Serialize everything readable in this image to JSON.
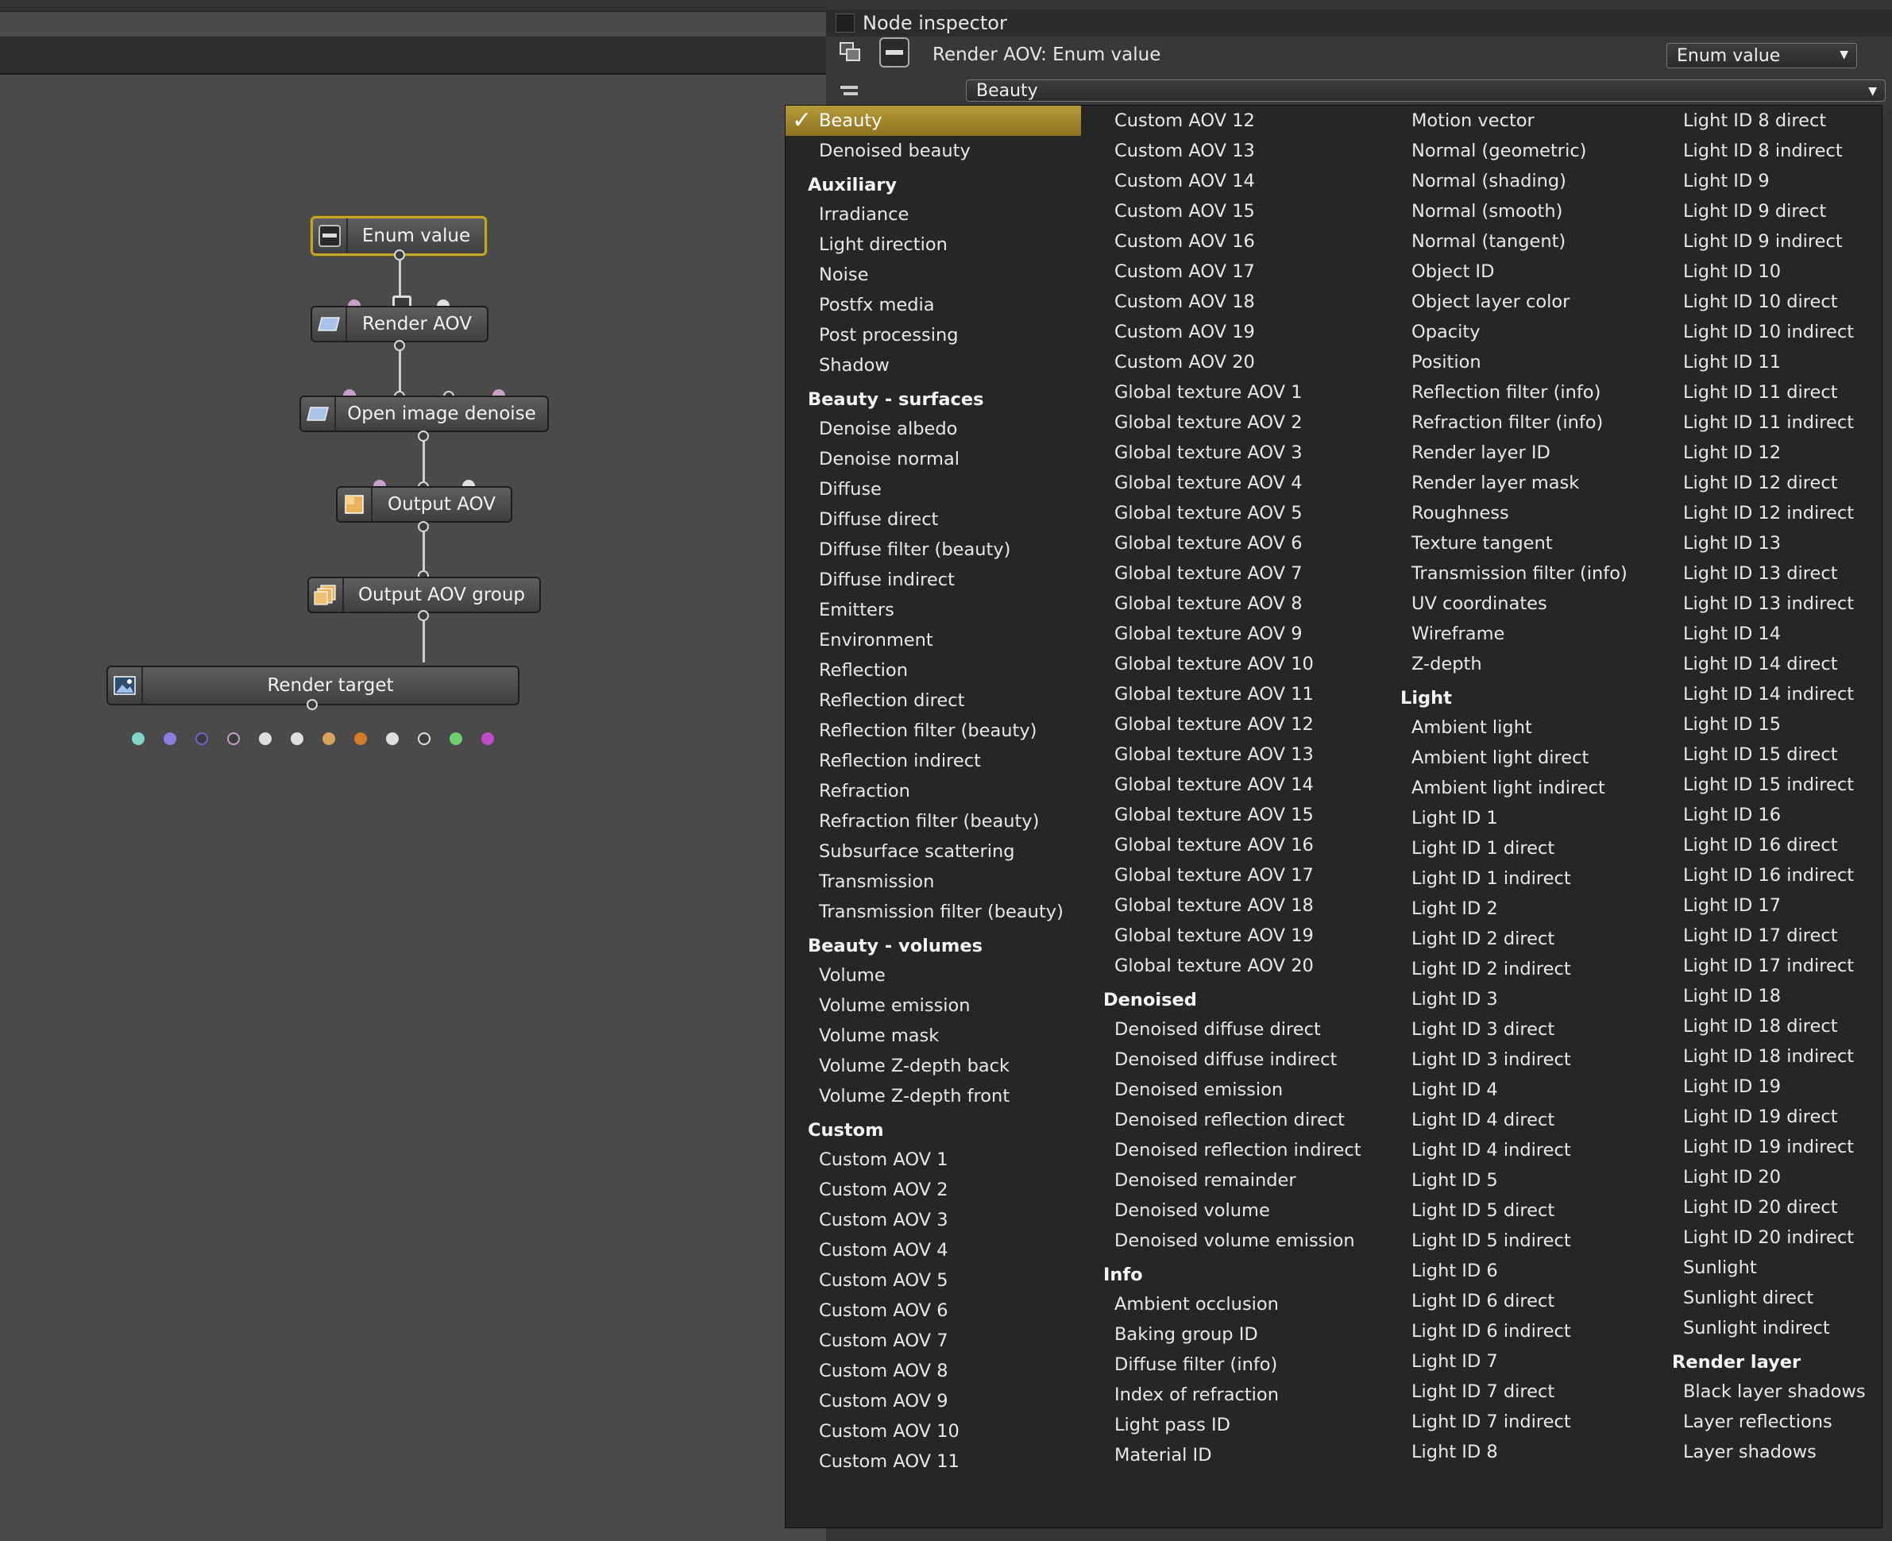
{
  "inspector": {
    "title": "Node inspector",
    "node_title": "Render AOV: Enum value",
    "type_dropdown": "Enum value",
    "value_dropdown": "Beauty"
  },
  "graph": {
    "nodes": {
      "enum_value": "Enum value",
      "render_aov": "Render AOV",
      "open_image_denoise": "Open image denoise",
      "output_aov": "Output AOV",
      "output_aov_group": "Output AOV group",
      "render_target": "Render target"
    }
  },
  "menu": {
    "selected": "Beauty",
    "columns": [
      [
        {
          "t": "i",
          "label": "Beauty",
          "selected": true
        },
        {
          "t": "i",
          "label": "Denoised beauty"
        },
        {
          "t": "h",
          "label": "Auxiliary"
        },
        {
          "t": "i",
          "label": "Irradiance"
        },
        {
          "t": "i",
          "label": "Light direction"
        },
        {
          "t": "i",
          "label": "Noise"
        },
        {
          "t": "i",
          "label": "Postfx media"
        },
        {
          "t": "i",
          "label": "Post processing"
        },
        {
          "t": "i",
          "label": "Shadow"
        },
        {
          "t": "h",
          "label": "Beauty - surfaces"
        },
        {
          "t": "i",
          "label": "Denoise albedo"
        },
        {
          "t": "i",
          "label": "Denoise normal"
        },
        {
          "t": "i",
          "label": "Diffuse"
        },
        {
          "t": "i",
          "label": "Diffuse direct"
        },
        {
          "t": "i",
          "label": "Diffuse filter (beauty)"
        },
        {
          "t": "i",
          "label": "Diffuse indirect"
        },
        {
          "t": "i",
          "label": "Emitters"
        },
        {
          "t": "i",
          "label": "Environment"
        },
        {
          "t": "i",
          "label": "Reflection"
        },
        {
          "t": "i",
          "label": "Reflection direct"
        },
        {
          "t": "i",
          "label": "Reflection filter (beauty)"
        },
        {
          "t": "i",
          "label": "Reflection indirect"
        },
        {
          "t": "i",
          "label": "Refraction"
        },
        {
          "t": "i",
          "label": "Refraction filter (beauty)"
        },
        {
          "t": "i",
          "label": "Subsurface scattering"
        },
        {
          "t": "i",
          "label": "Transmission"
        },
        {
          "t": "i",
          "label": "Transmission filter (beauty)"
        },
        {
          "t": "h",
          "label": "Beauty - volumes"
        },
        {
          "t": "i",
          "label": "Volume"
        },
        {
          "t": "i",
          "label": "Volume emission"
        },
        {
          "t": "i",
          "label": "Volume mask"
        },
        {
          "t": "i",
          "label": "Volume Z-depth back"
        },
        {
          "t": "i",
          "label": "Volume Z-depth front"
        },
        {
          "t": "h",
          "label": "Custom"
        },
        {
          "t": "i",
          "label": "Custom AOV 1"
        },
        {
          "t": "i",
          "label": "Custom AOV 2"
        },
        {
          "t": "i",
          "label": "Custom AOV 3"
        },
        {
          "t": "i",
          "label": "Custom AOV 4"
        },
        {
          "t": "i",
          "label": "Custom AOV 5"
        },
        {
          "t": "i",
          "label": "Custom AOV 6"
        },
        {
          "t": "i",
          "label": "Custom AOV 7"
        },
        {
          "t": "i",
          "label": "Custom AOV 8"
        },
        {
          "t": "i",
          "label": "Custom AOV 9"
        },
        {
          "t": "i",
          "label": "Custom AOV 10"
        },
        {
          "t": "i",
          "label": "Custom AOV 11"
        }
      ],
      [
        {
          "t": "i",
          "label": "Custom AOV 12"
        },
        {
          "t": "i",
          "label": "Custom AOV 13"
        },
        {
          "t": "i",
          "label": "Custom AOV 14"
        },
        {
          "t": "i",
          "label": "Custom AOV 15"
        },
        {
          "t": "i",
          "label": "Custom AOV 16"
        },
        {
          "t": "i",
          "label": "Custom AOV 17"
        },
        {
          "t": "i",
          "label": "Custom AOV 18"
        },
        {
          "t": "i",
          "label": "Custom AOV 19"
        },
        {
          "t": "i",
          "label": "Custom AOV 20"
        },
        {
          "t": "i",
          "label": "Global texture AOV 1"
        },
        {
          "t": "i",
          "label": "Global texture AOV 2"
        },
        {
          "t": "i",
          "label": "Global texture AOV 3"
        },
        {
          "t": "i",
          "label": "Global texture AOV 4"
        },
        {
          "t": "i",
          "label": "Global texture AOV 5"
        },
        {
          "t": "i",
          "label": "Global texture AOV 6"
        },
        {
          "t": "i",
          "label": "Global texture AOV 7"
        },
        {
          "t": "i",
          "label": "Global texture AOV 8"
        },
        {
          "t": "i",
          "label": "Global texture AOV 9"
        },
        {
          "t": "i",
          "label": "Global texture AOV 10"
        },
        {
          "t": "i",
          "label": "Global texture AOV 11"
        },
        {
          "t": "i",
          "label": "Global texture AOV 12"
        },
        {
          "t": "i",
          "label": "Global texture AOV 13"
        },
        {
          "t": "i",
          "label": "Global texture AOV 14"
        },
        {
          "t": "i",
          "label": "Global texture AOV 15"
        },
        {
          "t": "i",
          "label": "Global texture AOV 16"
        },
        {
          "t": "i",
          "label": "Global texture AOV 17"
        },
        {
          "t": "i",
          "label": "Global texture AOV 18"
        },
        {
          "t": "i",
          "label": "Global texture AOV 19"
        },
        {
          "t": "i",
          "label": "Global texture AOV 20"
        },
        {
          "t": "h",
          "label": "Denoised"
        },
        {
          "t": "i",
          "label": "Denoised diffuse direct"
        },
        {
          "t": "i",
          "label": "Denoised diffuse indirect"
        },
        {
          "t": "i",
          "label": "Denoised emission"
        },
        {
          "t": "i",
          "label": "Denoised reflection direct"
        },
        {
          "t": "i",
          "label": "Denoised reflection indirect"
        },
        {
          "t": "i",
          "label": "Denoised remainder"
        },
        {
          "t": "i",
          "label": "Denoised volume"
        },
        {
          "t": "i",
          "label": "Denoised volume emission"
        },
        {
          "t": "h",
          "label": "Info"
        },
        {
          "t": "i",
          "label": "Ambient occlusion"
        },
        {
          "t": "i",
          "label": "Baking group ID"
        },
        {
          "t": "i",
          "label": "Diffuse filter (info)"
        },
        {
          "t": "i",
          "label": "Index of refraction"
        },
        {
          "t": "i",
          "label": "Light pass ID"
        },
        {
          "t": "i",
          "label": "Material ID"
        }
      ],
      [
        {
          "t": "i",
          "label": "Motion vector"
        },
        {
          "t": "i",
          "label": "Normal (geometric)"
        },
        {
          "t": "i",
          "label": "Normal (shading)"
        },
        {
          "t": "i",
          "label": "Normal (smooth)"
        },
        {
          "t": "i",
          "label": "Normal (tangent)"
        },
        {
          "t": "i",
          "label": "Object ID"
        },
        {
          "t": "i",
          "label": "Object layer color"
        },
        {
          "t": "i",
          "label": "Opacity"
        },
        {
          "t": "i",
          "label": "Position"
        },
        {
          "t": "i",
          "label": "Reflection filter (info)"
        },
        {
          "t": "i",
          "label": "Refraction filter (info)"
        },
        {
          "t": "i",
          "label": "Render layer ID"
        },
        {
          "t": "i",
          "label": "Render layer mask"
        },
        {
          "t": "i",
          "label": "Roughness"
        },
        {
          "t": "i",
          "label": "Texture tangent"
        },
        {
          "t": "i",
          "label": "Transmission filter (info)"
        },
        {
          "t": "i",
          "label": "UV coordinates"
        },
        {
          "t": "i",
          "label": "Wireframe"
        },
        {
          "t": "i",
          "label": "Z-depth"
        },
        {
          "t": "h",
          "label": "Light"
        },
        {
          "t": "i",
          "label": "Ambient light"
        },
        {
          "t": "i",
          "label": "Ambient light direct"
        },
        {
          "t": "i",
          "label": "Ambient light indirect"
        },
        {
          "t": "i",
          "label": "Light ID 1"
        },
        {
          "t": "i",
          "label": "Light ID 1 direct"
        },
        {
          "t": "i",
          "label": "Light ID 1 indirect"
        },
        {
          "t": "i",
          "label": "Light ID 2"
        },
        {
          "t": "i",
          "label": "Light ID 2 direct"
        },
        {
          "t": "i",
          "label": "Light ID 2 indirect"
        },
        {
          "t": "i",
          "label": "Light ID 3"
        },
        {
          "t": "i",
          "label": "Light ID 3 direct"
        },
        {
          "t": "i",
          "label": "Light ID 3 indirect"
        },
        {
          "t": "i",
          "label": "Light ID 4"
        },
        {
          "t": "i",
          "label": "Light ID 4 direct"
        },
        {
          "t": "i",
          "label": "Light ID 4 indirect"
        },
        {
          "t": "i",
          "label": "Light ID 5"
        },
        {
          "t": "i",
          "label": "Light ID 5 direct"
        },
        {
          "t": "i",
          "label": "Light ID 5 indirect"
        },
        {
          "t": "i",
          "label": "Light ID 6"
        },
        {
          "t": "i",
          "label": "Light ID 6 direct"
        },
        {
          "t": "i",
          "label": "Light ID 6 indirect"
        },
        {
          "t": "i",
          "label": "Light ID 7"
        },
        {
          "t": "i",
          "label": "Light ID 7 direct"
        },
        {
          "t": "i",
          "label": "Light ID 7 indirect"
        },
        {
          "t": "i",
          "label": "Light ID 8"
        }
      ],
      [
        {
          "t": "i",
          "label": "Light ID 8 direct"
        },
        {
          "t": "i",
          "label": "Light ID 8 indirect"
        },
        {
          "t": "i",
          "label": "Light ID 9"
        },
        {
          "t": "i",
          "label": "Light ID 9 direct"
        },
        {
          "t": "i",
          "label": "Light ID 9 indirect"
        },
        {
          "t": "i",
          "label": "Light ID 10"
        },
        {
          "t": "i",
          "label": "Light ID 10 direct"
        },
        {
          "t": "i",
          "label": "Light ID 10 indirect"
        },
        {
          "t": "i",
          "label": "Light ID 11"
        },
        {
          "t": "i",
          "label": "Light ID 11 direct"
        },
        {
          "t": "i",
          "label": "Light ID 11 indirect"
        },
        {
          "t": "i",
          "label": "Light ID 12"
        },
        {
          "t": "i",
          "label": "Light ID 12 direct"
        },
        {
          "t": "i",
          "label": "Light ID 12 indirect"
        },
        {
          "t": "i",
          "label": "Light ID 13"
        },
        {
          "t": "i",
          "label": "Light ID 13 direct"
        },
        {
          "t": "i",
          "label": "Light ID 13 indirect"
        },
        {
          "t": "i",
          "label": "Light ID 14"
        },
        {
          "t": "i",
          "label": "Light ID 14 direct"
        },
        {
          "t": "i",
          "label": "Light ID 14 indirect"
        },
        {
          "t": "i",
          "label": "Light ID 15"
        },
        {
          "t": "i",
          "label": "Light ID 15 direct"
        },
        {
          "t": "i",
          "label": "Light ID 15 indirect"
        },
        {
          "t": "i",
          "label": "Light ID 16"
        },
        {
          "t": "i",
          "label": "Light ID 16 direct"
        },
        {
          "t": "i",
          "label": "Light ID 16 indirect"
        },
        {
          "t": "i",
          "label": "Light ID 17"
        },
        {
          "t": "i",
          "label": "Light ID 17 direct"
        },
        {
          "t": "i",
          "label": "Light ID 17 indirect"
        },
        {
          "t": "i",
          "label": "Light ID 18"
        },
        {
          "t": "i",
          "label": "Light ID 18 direct"
        },
        {
          "t": "i",
          "label": "Light ID 18 indirect"
        },
        {
          "t": "i",
          "label": "Light ID 19"
        },
        {
          "t": "i",
          "label": "Light ID 19 direct"
        },
        {
          "t": "i",
          "label": "Light ID 19 indirect"
        },
        {
          "t": "i",
          "label": "Light ID 20"
        },
        {
          "t": "i",
          "label": "Light ID 20 direct"
        },
        {
          "t": "i",
          "label": "Light ID 20 indirect"
        },
        {
          "t": "i",
          "label": "Sunlight"
        },
        {
          "t": "i",
          "label": "Sunlight direct"
        },
        {
          "t": "i",
          "label": "Sunlight indirect"
        },
        {
          "t": "h",
          "label": "Render layer"
        },
        {
          "t": "i",
          "label": "Black layer shadows"
        },
        {
          "t": "i",
          "label": "Layer reflections"
        },
        {
          "t": "i",
          "label": "Layer shadows"
        }
      ]
    ]
  },
  "colors": {
    "selection_accent": "#b69a38",
    "pin_colors": [
      "#7fd3c9",
      "#8a7fe0",
      "#6f62d1",
      "#c9a0c9",
      "#e0e0e0",
      "#e0e0e0",
      "#d9a25a",
      "#d27c2a",
      "#e0e0e0",
      "#e0e0e0",
      "#6ccf6c",
      "#c04ac8"
    ]
  }
}
